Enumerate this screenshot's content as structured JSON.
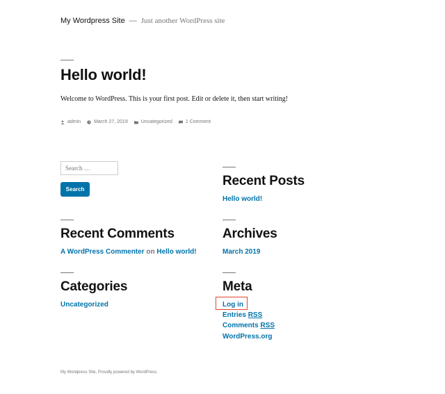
{
  "header": {
    "site_title": "My Wordpress Site",
    "separator": "—",
    "tagline": "Just another WordPress site"
  },
  "post": {
    "title": "Hello world!",
    "content": "Welcome to WordPress. This is your first post. Edit or delete it, then start writing!",
    "meta": {
      "author": "admin",
      "date": "March 27, 2019",
      "category": "Uncategorized",
      "comments": "1 Comment"
    }
  },
  "search": {
    "placeholder": "Search …",
    "button_label": "Search"
  },
  "widgets": {
    "recent_posts": {
      "title": "Recent Posts",
      "items": [
        "Hello world!"
      ]
    },
    "recent_comments": {
      "title": "Recent Comments",
      "author": "A WordPress Commenter",
      "on": "on",
      "post": "Hello world!"
    },
    "archives": {
      "title": "Archives",
      "items": [
        "March 2019"
      ]
    },
    "categories": {
      "title": "Categories",
      "items": [
        "Uncategorized"
      ]
    },
    "meta": {
      "title": "Meta",
      "login": "Log in",
      "entries": "Entries",
      "comments": "Comments",
      "rss": "RSS",
      "wordpress_org": "WordPress.org"
    }
  },
  "footer": {
    "text": "My Wordpress Site, Proudly powered by WordPress."
  },
  "colors": {
    "link": "#0073aa",
    "muted": "#767676",
    "highlight": "#e0452e"
  }
}
